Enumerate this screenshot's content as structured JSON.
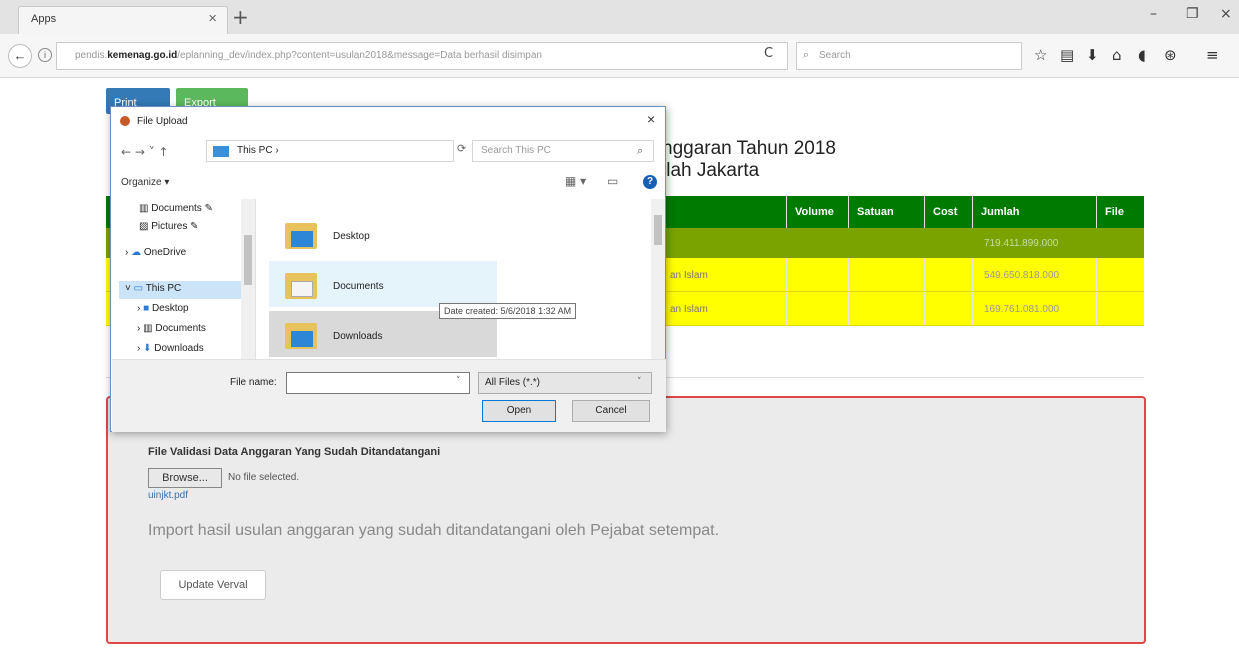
{
  "browser": {
    "tab_title": "Apps",
    "tab_close": "×",
    "new_tab": "+",
    "window_controls": {
      "minimize": "–",
      "restore": "❐",
      "close": "×"
    },
    "url_domain_prefix": "pendis.",
    "url_domain": "kemenag.go.id",
    "url_path": "/eplanning_dev/index.php?content=usulan2018&message=Data berhasil disimpan",
    "reload": "C",
    "search_placeholder": "Search",
    "toolbar_icons": [
      "star-icon",
      "reading-list-icon",
      "download-icon",
      "home-icon",
      "pocket-icon",
      "extension-icon",
      "menu-icon"
    ]
  },
  "page": {
    "print_label": "Print",
    "export_label": "Export",
    "heading_line1": "nggaran Tahun 2018",
    "heading_line2": "llah Jakarta",
    "table": {
      "headers": [
        "Volume",
        "Satuan",
        "Cost",
        "Jumlah",
        "File"
      ],
      "total_amount": "719.411.899.000",
      "rows": [
        {
          "description": "an Islam",
          "amount": "549.650.818.000"
        },
        {
          "description": "an Islam",
          "amount": "169.761.081.000"
        }
      ]
    },
    "upload_panel": {
      "label": "File Validasi Data Anggaran Yang Sudah Ditandatangani",
      "browse_label": "Browse...",
      "no_file_text": "No file selected.",
      "file_link": "uinjkt.pdf",
      "import_text": "Import hasil usulan anggaran yang sudah ditandatangani oleh Pejabat setempat.",
      "update_label": "Update Verval"
    }
  },
  "dialog": {
    "title": "File Upload",
    "close": "×",
    "path_text": "This PC ›",
    "path_prefix": "›",
    "search_placeholder": "Search This PC",
    "organize_label": "Organize ▾",
    "help": "?",
    "nav_tree": [
      {
        "label": "Documents",
        "icon": "documents-icon",
        "pin": "✎"
      },
      {
        "label": "Pictures",
        "icon": "pictures-icon",
        "pin": "✎"
      },
      {
        "label": "OneDrive",
        "icon": "onedrive-icon"
      },
      {
        "label": "This PC",
        "icon": "this-pc-icon",
        "selected": true
      },
      {
        "label": "Desktop",
        "icon": "desktop-icon"
      },
      {
        "label": "Documents",
        "icon": "documents-icon"
      },
      {
        "label": "Downloads",
        "icon": "downloads-icon"
      }
    ],
    "files": [
      {
        "name": "Desktop",
        "icon": "desktop-folder-icon"
      },
      {
        "name": "Documents",
        "icon": "documents-folder-icon",
        "hover": true
      },
      {
        "name": "Downloads",
        "icon": "downloads-folder-icon",
        "selected": true
      }
    ],
    "tooltip": "Date created: 5/6/2018 1:32 AM",
    "file_name_label": "File name:",
    "file_name_value": "",
    "filter_label": "All Files (*.*)",
    "open_label": "Open",
    "cancel_label": "Cancel"
  }
}
